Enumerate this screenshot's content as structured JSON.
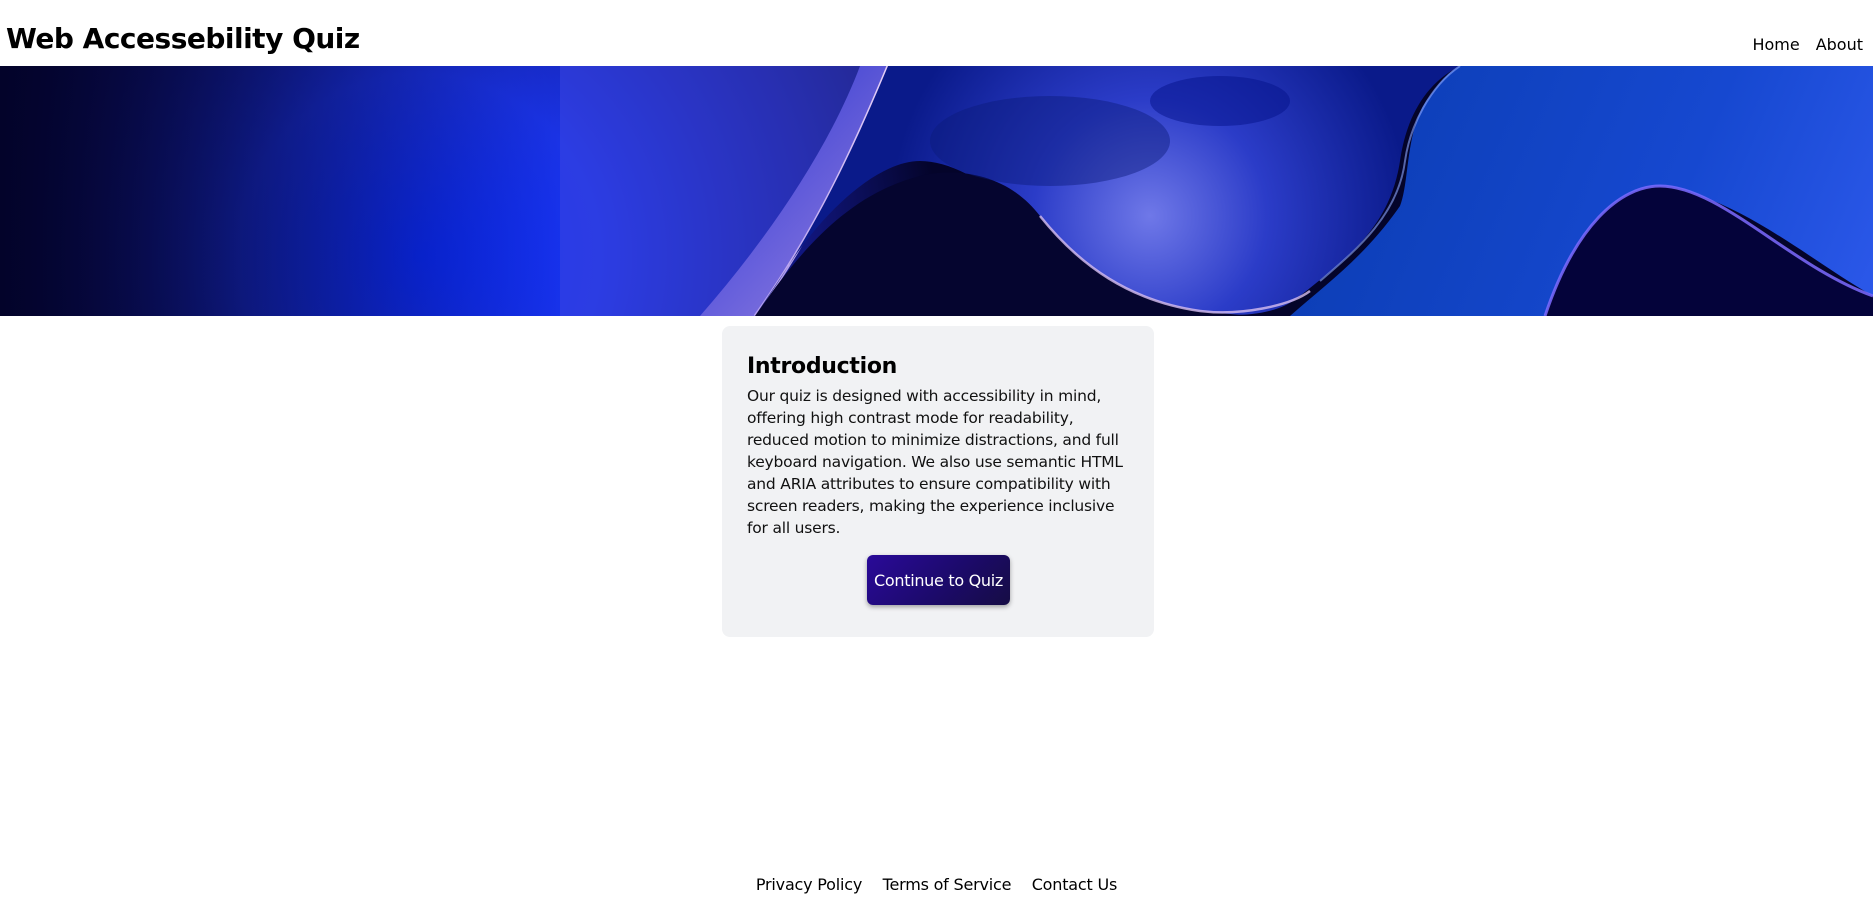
{
  "header": {
    "title": "Web Accessebility Quiz",
    "nav": [
      {
        "label": "Home"
      },
      {
        "label": "About"
      }
    ]
  },
  "hero": {
    "image": "abstract-blue-wave-banner",
    "colors": {
      "dark": "#05052e",
      "deep_blue": "#0a1fd0",
      "bright_blue": "#1437ff",
      "highlight": "#e8c6f2"
    }
  },
  "card": {
    "heading": "Introduction",
    "body": "Our quiz is designed with accessibility in mind, offering high contrast mode for readability, reduced motion to minimize distractions, and full keyboard navigation. We also use semantic HTML and ARIA attributes to ensure compatibility with screen readers, making the experience inclusive for all users.",
    "button_label": "Continue to Quiz",
    "button_color": "#1f0a80"
  },
  "footer": {
    "links": [
      {
        "label": "Privacy Policy"
      },
      {
        "label": "Terms of Service"
      },
      {
        "label": "Contact Us"
      }
    ]
  }
}
